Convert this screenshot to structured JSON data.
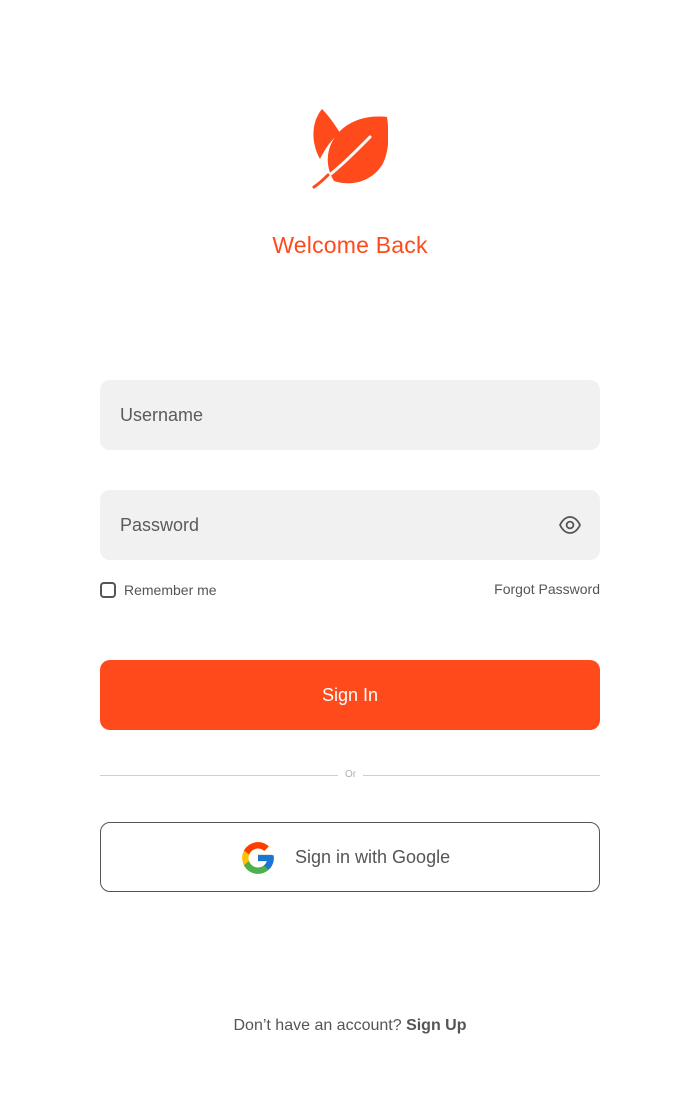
{
  "brand": {
    "logo_icon": "leaf-icon",
    "accent_color": "#ff4a1c",
    "welcome_text": "Welcome Back"
  },
  "form": {
    "username": {
      "placeholder": "Username",
      "value": ""
    },
    "password": {
      "placeholder": "Password",
      "value": "",
      "toggle_icon": "eye-icon"
    },
    "remember_label": "Remember me",
    "remember_checked": false,
    "forgot_label": "Forgot Password",
    "submit_label": "Sign In"
  },
  "divider": {
    "label": "Or"
  },
  "google": {
    "icon": "google-icon",
    "label": "Sign in with Google"
  },
  "footer": {
    "prompt": "Don’t have an account?",
    "signup_label": "Sign Up"
  }
}
